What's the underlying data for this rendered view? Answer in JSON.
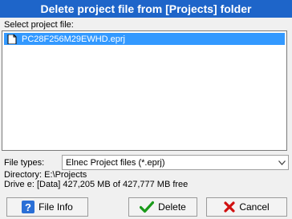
{
  "window": {
    "title": "Delete project file from [Projects] folder"
  },
  "file_list": {
    "label": "Select project file:",
    "items": [
      {
        "name": "PC28F256M29EWHD.eprj",
        "selected": true
      }
    ]
  },
  "file_types": {
    "label": "File types:",
    "selected": "Elnec Project files (*.eprj)"
  },
  "info": {
    "directory": "Directory: E:\\Projects",
    "drive": "Drive e: [Data]  427,205 MB of 427,777 MB free"
  },
  "buttons": {
    "file_info": "File Info",
    "delete": "Delete",
    "cancel": "Cancel"
  },
  "colors": {
    "title_bg": "#1e65c9",
    "selection": "#3399ff",
    "delete_check": "#1a9a1a",
    "cancel_x": "#d01010",
    "info_icon": "#2a6fd6"
  }
}
